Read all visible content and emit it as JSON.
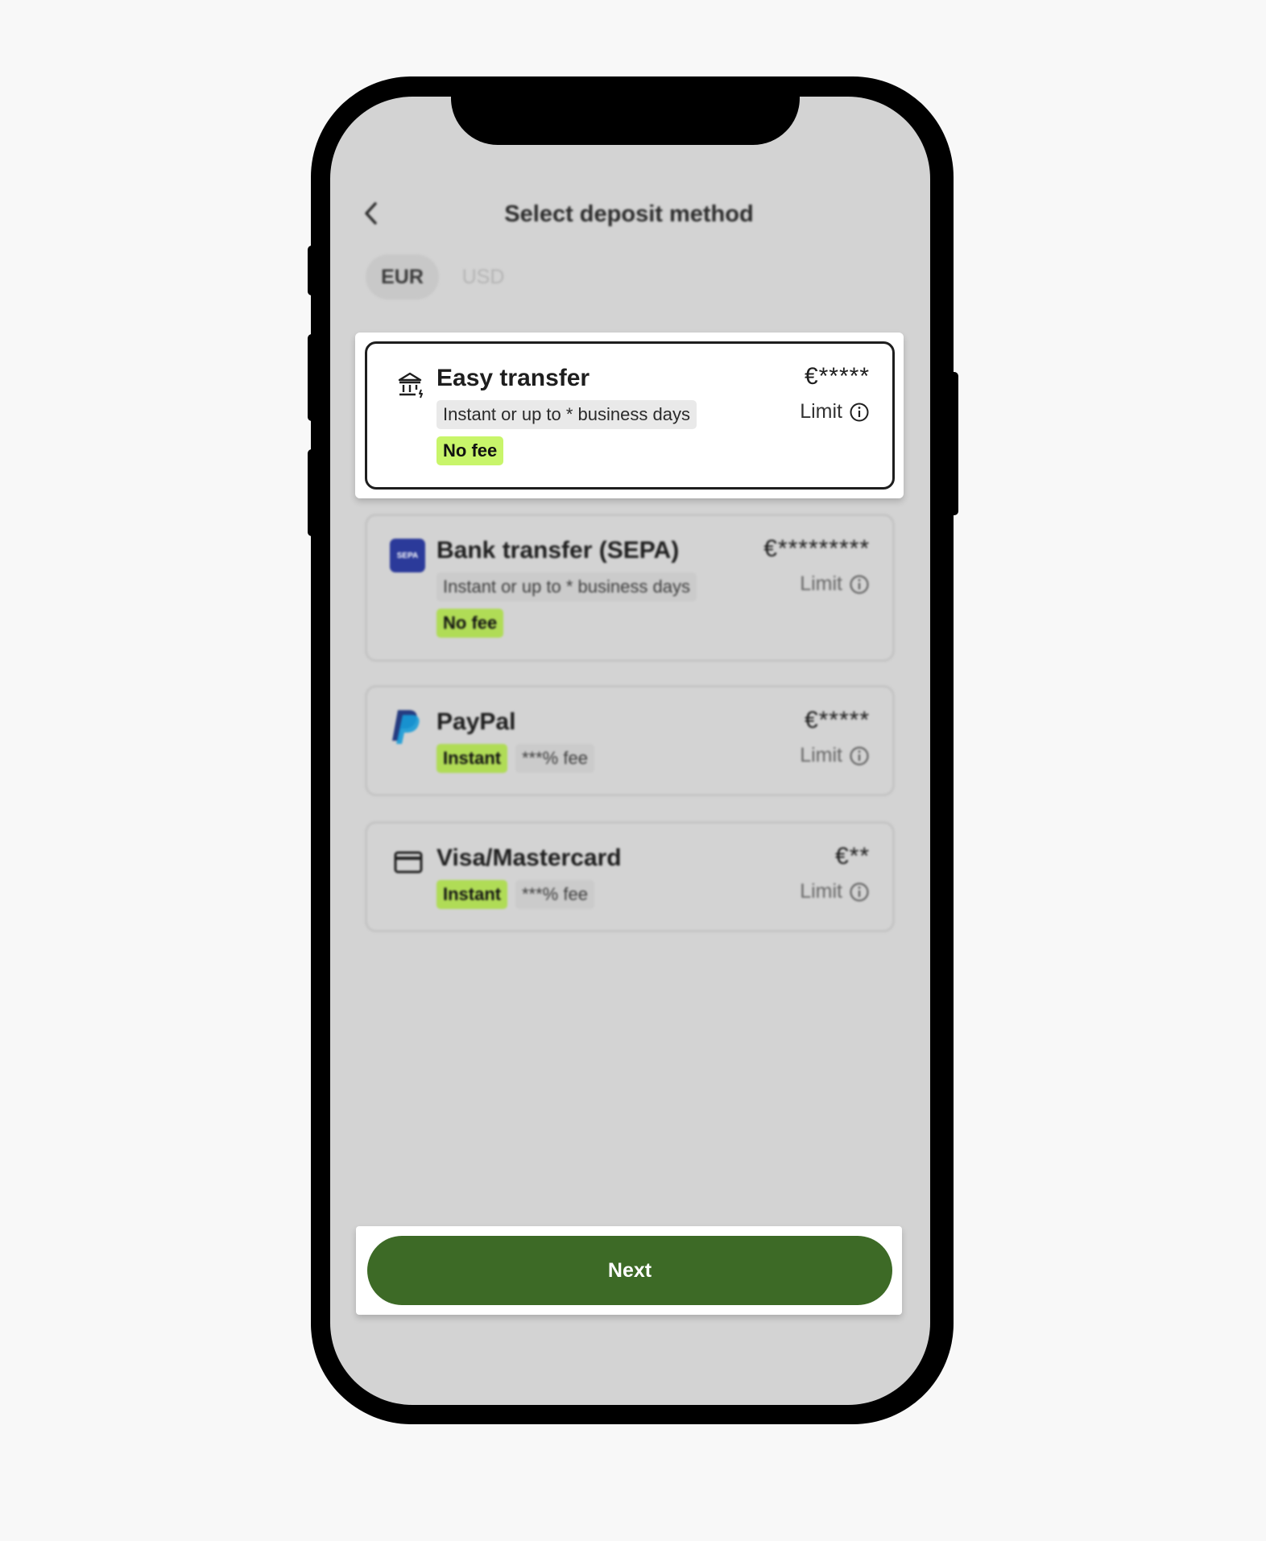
{
  "header": {
    "back_icon": "chevron-left-icon",
    "title": "Select deposit method"
  },
  "currency_tabs": [
    {
      "label": "EUR",
      "selected": true
    },
    {
      "label": "USD",
      "selected": false
    }
  ],
  "methods": [
    {
      "icon": "bank-icon",
      "title": "Easy transfer",
      "subtitle": "Instant or up to * business days",
      "badge": "No fee",
      "amount": "€*****",
      "limit_label": "Limit",
      "selected": true
    },
    {
      "icon": "sepa-icon",
      "icon_text": "SEPA",
      "title": "Bank transfer (SEPA)",
      "subtitle": "Instant or up to * business days",
      "badge": "No fee",
      "amount": "€*********",
      "limit_label": "Limit",
      "selected": false
    },
    {
      "icon": "paypal-icon",
      "title": "PayPal",
      "badge": "Instant",
      "fee": "***% fee",
      "amount": "€*****",
      "limit_label": "Limit",
      "selected": false
    },
    {
      "icon": "credit-card-icon",
      "title": "Visa/Mastercard",
      "badge": "Instant",
      "fee": "***% fee",
      "amount": "€**",
      "limit_label": "Limit",
      "selected": false
    }
  ],
  "footer": {
    "next_label": "Next"
  },
  "colors": {
    "accent_green": "#3d6a26",
    "badge_green": "#c8f56a",
    "screen_bg": "#d3d3d3"
  }
}
